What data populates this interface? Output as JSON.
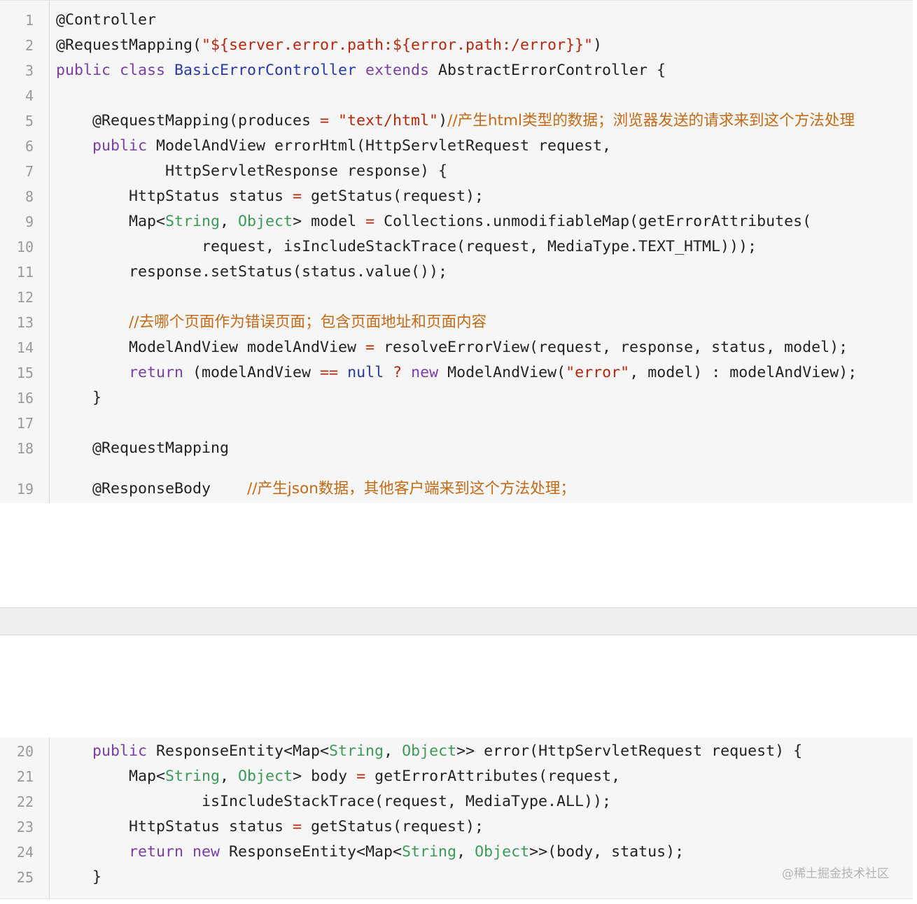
{
  "top_block": {
    "lines": [
      {
        "num": "1",
        "segs": [
          {
            "t": "@Controller",
            "c": "plain"
          }
        ]
      },
      {
        "num": "2",
        "segs": [
          {
            "t": "@RequestMapping(",
            "c": "plain"
          },
          {
            "t": "\"${server.error.path:${error.path:/error}}\"",
            "c": "str"
          },
          {
            "t": ")",
            "c": "plain"
          }
        ]
      },
      {
        "num": "3",
        "segs": [
          {
            "t": "public class ",
            "c": "kw"
          },
          {
            "t": "BasicErrorController",
            "c": "cls"
          },
          {
            "t": " extends ",
            "c": "kw"
          },
          {
            "t": "AbstractErrorController {",
            "c": "plain"
          }
        ]
      },
      {
        "num": "4",
        "segs": []
      },
      {
        "num": "5",
        "segs": [
          {
            "t": "    @RequestMapping(produces ",
            "c": "plain"
          },
          {
            "t": "=",
            "c": "op"
          },
          {
            "t": " ",
            "c": "plain"
          },
          {
            "t": "\"text/html\"",
            "c": "str"
          },
          {
            "t": ")",
            "c": "plain"
          },
          {
            "t": "//产生html类型的数据；浏览器发送的请求来到这个方法处理",
            "c": "cmt"
          }
        ]
      },
      {
        "num": "6",
        "segs": [
          {
            "t": "    ",
            "c": "plain"
          },
          {
            "t": "public",
            "c": "kw"
          },
          {
            "t": " ModelAndView errorHtml(HttpServletRequest request,",
            "c": "plain"
          }
        ]
      },
      {
        "num": "7",
        "segs": [
          {
            "t": "            HttpServletResponse response) {",
            "c": "plain"
          }
        ]
      },
      {
        "num": "8",
        "segs": [
          {
            "t": "        HttpStatus status ",
            "c": "plain"
          },
          {
            "t": "=",
            "c": "op"
          },
          {
            "t": " getStatus(request);",
            "c": "plain"
          }
        ]
      },
      {
        "num": "9",
        "segs": [
          {
            "t": "        Map<",
            "c": "plain"
          },
          {
            "t": "String",
            "c": "gen"
          },
          {
            "t": ", ",
            "c": "plain"
          },
          {
            "t": "Object",
            "c": "gen"
          },
          {
            "t": "> model ",
            "c": "plain"
          },
          {
            "t": "=",
            "c": "op"
          },
          {
            "t": " Collections.unmodifiableMap(getErrorAttributes(",
            "c": "plain"
          }
        ]
      },
      {
        "num": "10",
        "segs": [
          {
            "t": "                request, isIncludeStackTrace(request, MediaType.TEXT_HTML)));",
            "c": "plain"
          }
        ]
      },
      {
        "num": "11",
        "segs": [
          {
            "t": "        response.setStatus(status.value());",
            "c": "plain"
          }
        ]
      },
      {
        "num": "12",
        "segs": []
      },
      {
        "num": "13",
        "segs": [
          {
            "t": "        ",
            "c": "plain"
          },
          {
            "t": "//去哪个页面作为错误页面；包含页面地址和页面内容",
            "c": "cmt"
          }
        ]
      },
      {
        "num": "14",
        "segs": [
          {
            "t": "        ModelAndView modelAndView ",
            "c": "plain"
          },
          {
            "t": "=",
            "c": "op"
          },
          {
            "t": " resolveErrorView(request, response, status, model);",
            "c": "plain"
          }
        ]
      },
      {
        "num": "15",
        "segs": [
          {
            "t": "        ",
            "c": "plain"
          },
          {
            "t": "return",
            "c": "kw"
          },
          {
            "t": " (modelAndView ",
            "c": "plain"
          },
          {
            "t": "==",
            "c": "op"
          },
          {
            "t": " ",
            "c": "plain"
          },
          {
            "t": "null",
            "c": "cls"
          },
          {
            "t": " ",
            "c": "plain"
          },
          {
            "t": "?",
            "c": "op"
          },
          {
            "t": " ",
            "c": "plain"
          },
          {
            "t": "new",
            "c": "kw"
          },
          {
            "t": " ModelAndView(",
            "c": "plain"
          },
          {
            "t": "\"error\"",
            "c": "str"
          },
          {
            "t": ", model) : modelAndView);",
            "c": "plain"
          }
        ]
      },
      {
        "num": "16",
        "segs": [
          {
            "t": "    }",
            "c": "plain"
          }
        ]
      },
      {
        "num": "17",
        "segs": []
      },
      {
        "num": "18",
        "segs": [
          {
            "t": "    @RequestMapping",
            "c": "plain"
          }
        ]
      },
      {
        "num": "19",
        "segs": [
          {
            "t": "    @ResponseBody    ",
            "c": "plain"
          },
          {
            "t": "//产生json数据，其他客户端来到这个方法处理；",
            "c": "cmt"
          }
        ]
      }
    ]
  },
  "bottom_block": {
    "lines": [
      {
        "num": "20",
        "segs": [
          {
            "t": "    ",
            "c": "plain"
          },
          {
            "t": "public",
            "c": "kw"
          },
          {
            "t": " ResponseEntity<Map<",
            "c": "plain"
          },
          {
            "t": "String",
            "c": "gen"
          },
          {
            "t": ", ",
            "c": "plain"
          },
          {
            "t": "Object",
            "c": "gen"
          },
          {
            "t": ">> error(HttpServletRequest request) {",
            "c": "plain"
          }
        ]
      },
      {
        "num": "21",
        "segs": [
          {
            "t": "        Map<",
            "c": "plain"
          },
          {
            "t": "String",
            "c": "gen"
          },
          {
            "t": ", ",
            "c": "plain"
          },
          {
            "t": "Object",
            "c": "gen"
          },
          {
            "t": "> body ",
            "c": "plain"
          },
          {
            "t": "=",
            "c": "op"
          },
          {
            "t": " getErrorAttributes(request,",
            "c": "plain"
          }
        ]
      },
      {
        "num": "22",
        "segs": [
          {
            "t": "                isIncludeStackTrace(request, MediaType.ALL));",
            "c": "plain"
          }
        ]
      },
      {
        "num": "23",
        "segs": [
          {
            "t": "        HttpStatus status ",
            "c": "plain"
          },
          {
            "t": "=",
            "c": "op"
          },
          {
            "t": " getStatus(request);",
            "c": "plain"
          }
        ]
      },
      {
        "num": "24",
        "segs": [
          {
            "t": "        ",
            "c": "plain"
          },
          {
            "t": "return new",
            "c": "kw"
          },
          {
            "t": " ResponseEntity<Map<",
            "c": "plain"
          },
          {
            "t": "String",
            "c": "gen"
          },
          {
            "t": ", ",
            "c": "plain"
          },
          {
            "t": "Object",
            "c": "gen"
          },
          {
            "t": ">>(body, status);",
            "c": "plain"
          }
        ]
      },
      {
        "num": "25",
        "segs": [
          {
            "t": "    }",
            "c": "plain"
          }
        ]
      }
    ]
  },
  "watermark": "@稀土掘金技术社区",
  "colors": {
    "keyword": "#7a3fa6",
    "string": "#b8260c",
    "comment": "#c46a16",
    "class_name": "#2a39a8",
    "generic_type": "#3c9a58",
    "line_number": "#999999",
    "background": "#f6f6f6"
  }
}
